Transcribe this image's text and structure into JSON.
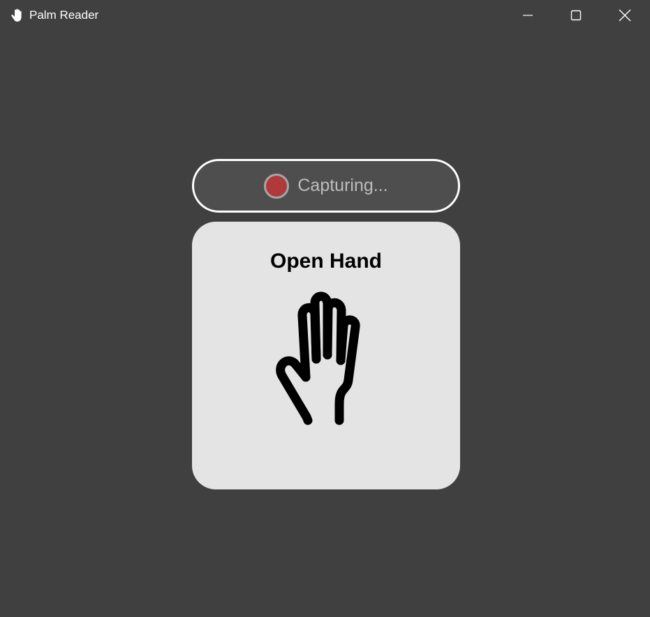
{
  "window": {
    "title": "Palm Reader",
    "app_icon": "hand-icon",
    "controls": {
      "minimize": "minimize-icon",
      "maximize": "maximize-icon",
      "close": "close-icon"
    }
  },
  "status": {
    "label": "Capturing...",
    "indicator_color": "#b03a3a",
    "icon": "record-icon"
  },
  "gesture": {
    "name": "Open Hand",
    "icon": "open-hand-icon"
  },
  "colors": {
    "background": "#404040",
    "card": "#e4e4e4",
    "pill": "#4e4e4e",
    "recording": "#b03a3a"
  }
}
